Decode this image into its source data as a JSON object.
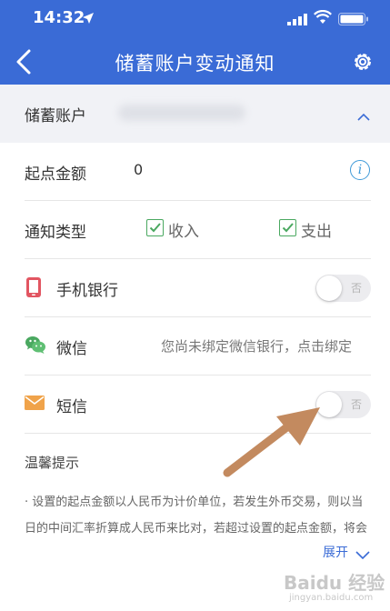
{
  "status": {
    "time": "14:32"
  },
  "nav": {
    "title": "储蓄账户变动通知"
  },
  "account": {
    "label": "储蓄账户"
  },
  "rows": {
    "start_amount": {
      "label": "起点金额",
      "value": "0"
    },
    "notify_type": {
      "label": "通知类型",
      "income": "收入",
      "expense": "支出"
    },
    "mobile_bank": {
      "label": "手机银行",
      "toggle": "否"
    },
    "wechat": {
      "label": "微信",
      "hint": "您尚未绑定微信银行，点击绑定"
    },
    "sms": {
      "label": "短信",
      "toggle": "否"
    }
  },
  "tips": {
    "title": "温馨提示",
    "text": "· 设置的起点金额以人民币为计价单位，若发生外币交易，则以当日的中间汇率折算成人民币来比对，若超过设置的起点金额，将会发送通知。",
    "expand": "展开"
  },
  "watermark": {
    "main": "Baidu 经验",
    "sub": "jingyan.baidu.com"
  },
  "colors": {
    "header": "#3a6bd6",
    "accent_blue": "#3f9ad8",
    "check_green": "#4aa860",
    "sms_orange": "#f0a34a",
    "phone_red": "#e25561",
    "arrow": "#c38a5f"
  }
}
